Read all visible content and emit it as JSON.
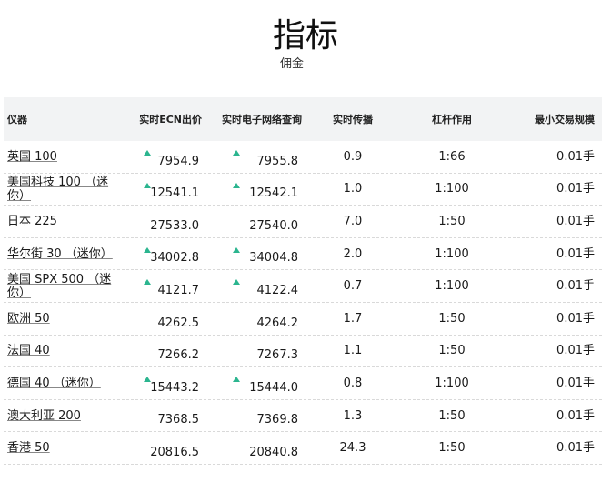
{
  "header": {
    "title": "指标",
    "subtitle": "佣金"
  },
  "table": {
    "columns": [
      "仪器",
      "实时ECN出价",
      "实时电子网络查询",
      "实时传播",
      "杠杆作用",
      "最小交易规模"
    ],
    "rows": [
      {
        "instrument": "英国 100",
        "bid": "7954.9",
        "ask": "7955.8",
        "bid_up": true,
        "ask_up": true,
        "spread": "0.9",
        "leverage": "1:66",
        "min_size": "0.01手"
      },
      {
        "instrument": "美国科技 100 （迷你）",
        "bid": "12541.1",
        "ask": "12542.1",
        "bid_up": true,
        "ask_up": true,
        "spread": "1.0",
        "leverage": "1:100",
        "min_size": "0.01手"
      },
      {
        "instrument": "日本 225",
        "bid": "27533.0",
        "ask": "27540.0",
        "bid_up": false,
        "ask_up": false,
        "spread": "7.0",
        "leverage": "1:50",
        "min_size": "0.01手"
      },
      {
        "instrument": "华尔街 30 （迷你）",
        "bid": "34002.8",
        "ask": "34004.8",
        "bid_up": true,
        "ask_up": true,
        "spread": "2.0",
        "leverage": "1:100",
        "min_size": "0.01手"
      },
      {
        "instrument": "美国 SPX 500 （迷你）",
        "bid": "4121.7",
        "ask": "4122.4",
        "bid_up": true,
        "ask_up": true,
        "spread": "0.7",
        "leverage": "1:100",
        "min_size": "0.01手"
      },
      {
        "instrument": "欧洲 50",
        "bid": "4262.5",
        "ask": "4264.2",
        "bid_up": false,
        "ask_up": false,
        "spread": "1.7",
        "leverage": "1:50",
        "min_size": "0.01手"
      },
      {
        "instrument": "法国 40",
        "bid": "7266.2",
        "ask": "7267.3",
        "bid_up": false,
        "ask_up": false,
        "spread": "1.1",
        "leverage": "1:50",
        "min_size": "0.01手"
      },
      {
        "instrument": "德国 40 （迷你）",
        "bid": "15443.2",
        "ask": "15444.0",
        "bid_up": true,
        "ask_up": true,
        "spread": "0.8",
        "leverage": "1:100",
        "min_size": "0.01手"
      },
      {
        "instrument": "澳大利亚 200",
        "bid": "7368.5",
        "ask": "7369.8",
        "bid_up": false,
        "ask_up": false,
        "spread": "1.3",
        "leverage": "1:50",
        "min_size": "0.01手"
      },
      {
        "instrument": "香港 50",
        "bid": "20816.5",
        "ask": "20840.8",
        "bid_up": false,
        "ask_up": false,
        "spread": "24.3",
        "leverage": "1:50",
        "min_size": "0.01手"
      }
    ]
  },
  "colors": {
    "up_arrow": "#2bb58f",
    "header_bg": "#f2f3f4"
  }
}
